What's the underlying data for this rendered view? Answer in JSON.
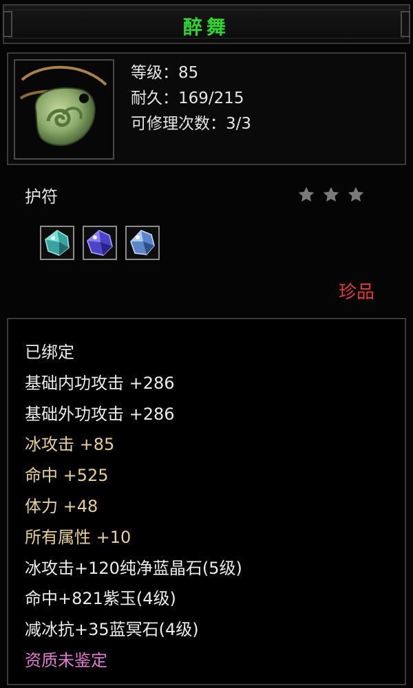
{
  "title": "醉舞",
  "stats": {
    "level": "等级：85",
    "durability": "耐久：169/215",
    "repair_count": "可修理次数：3/3"
  },
  "item_type": "护符",
  "stars": 3,
  "gems": [
    "green-crystal-gem-icon",
    "purple-jade-gem-icon",
    "blue-sapphire-gem-icon"
  ],
  "rarity": "珍品",
  "attributes": [
    {
      "text": "已绑定",
      "color": "white"
    },
    {
      "text": "基础内功攻击  +286",
      "color": "white"
    },
    {
      "text": "基础外功攻击  +286",
      "color": "white"
    },
    {
      "text": "冰攻击  +85",
      "color": "gold"
    },
    {
      "text": "命中  +525",
      "color": "gold"
    },
    {
      "text": "体力  +48",
      "color": "gold"
    },
    {
      "text": "所有属性  +10",
      "color": "gold"
    },
    {
      "text": "冰攻击+120纯净蓝晶石(5级)",
      "color": "white"
    },
    {
      "text": "命中+821紫玉(4级)",
      "color": "white"
    },
    {
      "text": "减冰抗+35蓝冥石(4级)",
      "color": "white"
    },
    {
      "text": "资质未鉴定",
      "color": "pink"
    }
  ],
  "colors": {
    "title": "#2fd52f",
    "rarity": "#e23a3a",
    "gold": "#e7cf96",
    "pink": "#e07bd3"
  }
}
